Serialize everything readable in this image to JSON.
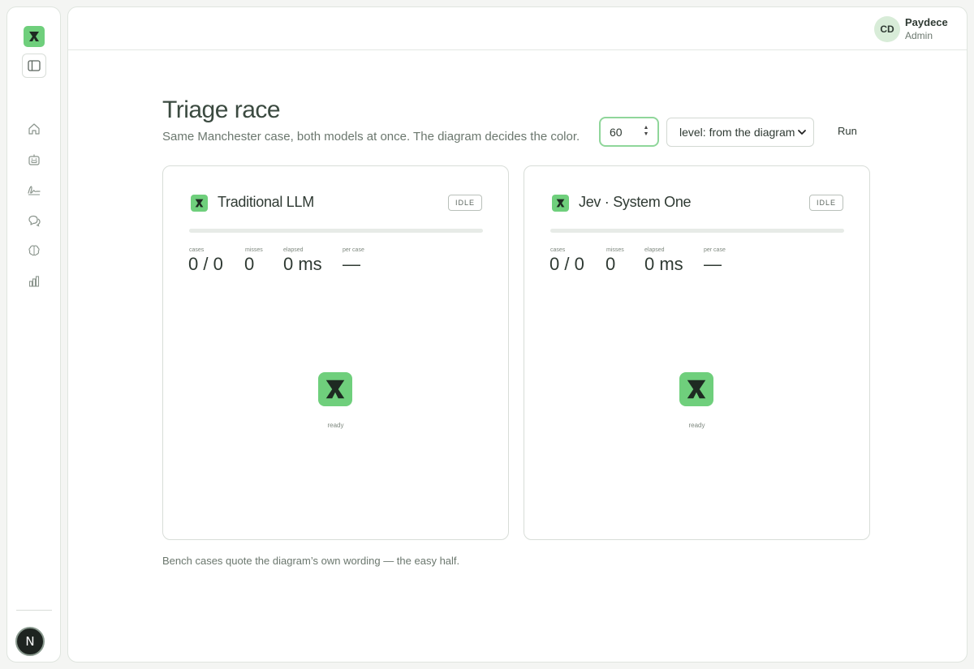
{
  "sidebar": {
    "nav": [
      "home-icon",
      "bot-icon",
      "signature-icon",
      "chat-icon",
      "brain-icon",
      "chart-icon"
    ],
    "bottom_avatar": "N"
  },
  "topbar": {
    "user_initials": "CD",
    "user_name": "Paydece",
    "user_role": "Admin"
  },
  "page": {
    "title": "Triage race",
    "subtitle": "Same Manchester case, both models at once. The diagram decides the color.",
    "count_value": "60",
    "level_select": "level: from the diagram",
    "run_label": "Run",
    "footnote": "Bench cases quote the diagram’s own wording — the easy half."
  },
  "stat_labels": {
    "cases": "cases",
    "misses": "misses",
    "elapsed": "elapsed",
    "per_case": "per case"
  },
  "cards": [
    {
      "title": "Traditional LLM",
      "status": "IDLE",
      "cases": "0 / 0",
      "misses": "0",
      "elapsed": "0 ms",
      "per_case": "—",
      "state": "ready"
    },
    {
      "title": "Jev · System One",
      "status": "IDLE",
      "cases": "0 / 0",
      "misses": "0",
      "elapsed": "0 ms",
      "per_case": "—",
      "state": "ready"
    }
  ],
  "colors": {
    "accent": "#6fcf7c",
    "logo_ink": "#1e2a22"
  }
}
